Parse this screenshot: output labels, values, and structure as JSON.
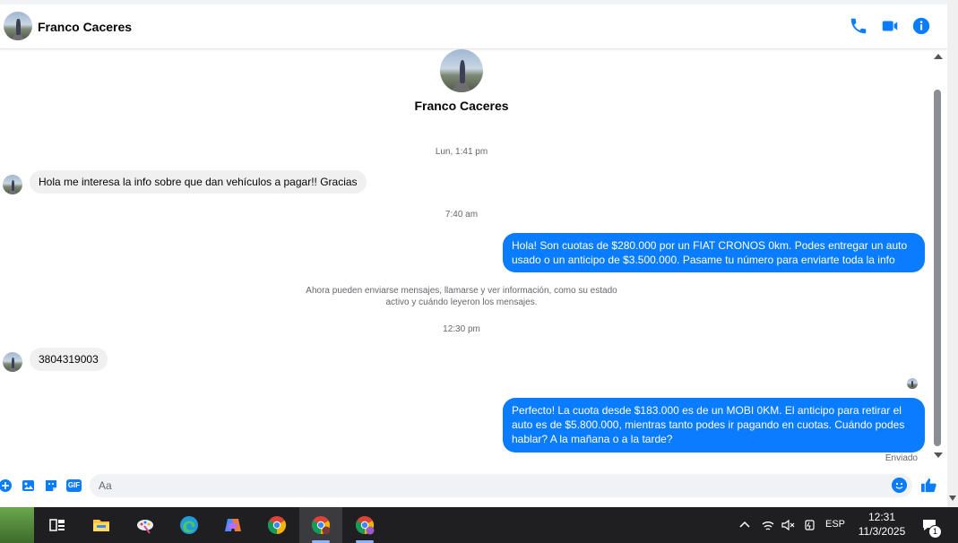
{
  "header": {
    "contact_name": "Franco Caceres",
    "actions": [
      "phone-icon",
      "video-icon",
      "info-icon"
    ]
  },
  "profile": {
    "name": "Franco Caceres"
  },
  "messages": [
    {
      "kind": "timestamp",
      "text": "Lun, 1:41 pm"
    },
    {
      "kind": "incoming",
      "text": "Hola me interesa la info sobre que dan vehículos a pagar!! Gracias"
    },
    {
      "kind": "timestamp",
      "text": "7:40 am"
    },
    {
      "kind": "outgoing",
      "lines": [
        "Hola! Son cuotas de $280.000 por un FIAT CRONOS 0km. Podes entregar un auto",
        "usado o un anticipo de $3.500.000. Pasame tu número para enviarte toda la info"
      ]
    },
    {
      "kind": "notice",
      "lines": [
        "Ahora pueden enviarse mensajes, llamarse y ver información, como su estado",
        "activo y cuándo leyeron los mensajes."
      ]
    },
    {
      "kind": "timestamp",
      "text": "12:30 pm"
    },
    {
      "kind": "incoming",
      "text": "3804319003"
    },
    {
      "kind": "outgoing",
      "lines": [
        "Perfecto! La cuota desde $183.000 es de un MOBI 0KM. El anticipo para retirar el",
        "auto es de $5.800.000, mientras tanto podes ir pagando en cuotas. Cuándo podes",
        "hablar? A la mañana o a la tarde?"
      ]
    }
  ],
  "status": {
    "sent_label": "Enviado"
  },
  "composer": {
    "placeholder": "Aa",
    "tools": [
      "plus-icon",
      "image-icon",
      "sticker-icon",
      "gif-icon"
    ],
    "gif_label": "GIF"
  },
  "taskbar": {
    "apps": [
      "file-explorer-icon",
      "paint-icon",
      "edge-icon",
      "copilot-icon",
      "chrome-icon",
      "chrome-profile-icon",
      "chrome-profile-2-icon"
    ],
    "language": "ESP",
    "time": "12:31",
    "date": "11/3/2025",
    "notification_count": "1"
  },
  "colors": {
    "accent": "#0a7cff",
    "incoming_bubble": "#f0f0f0",
    "taskbar": "#1f1f22"
  }
}
